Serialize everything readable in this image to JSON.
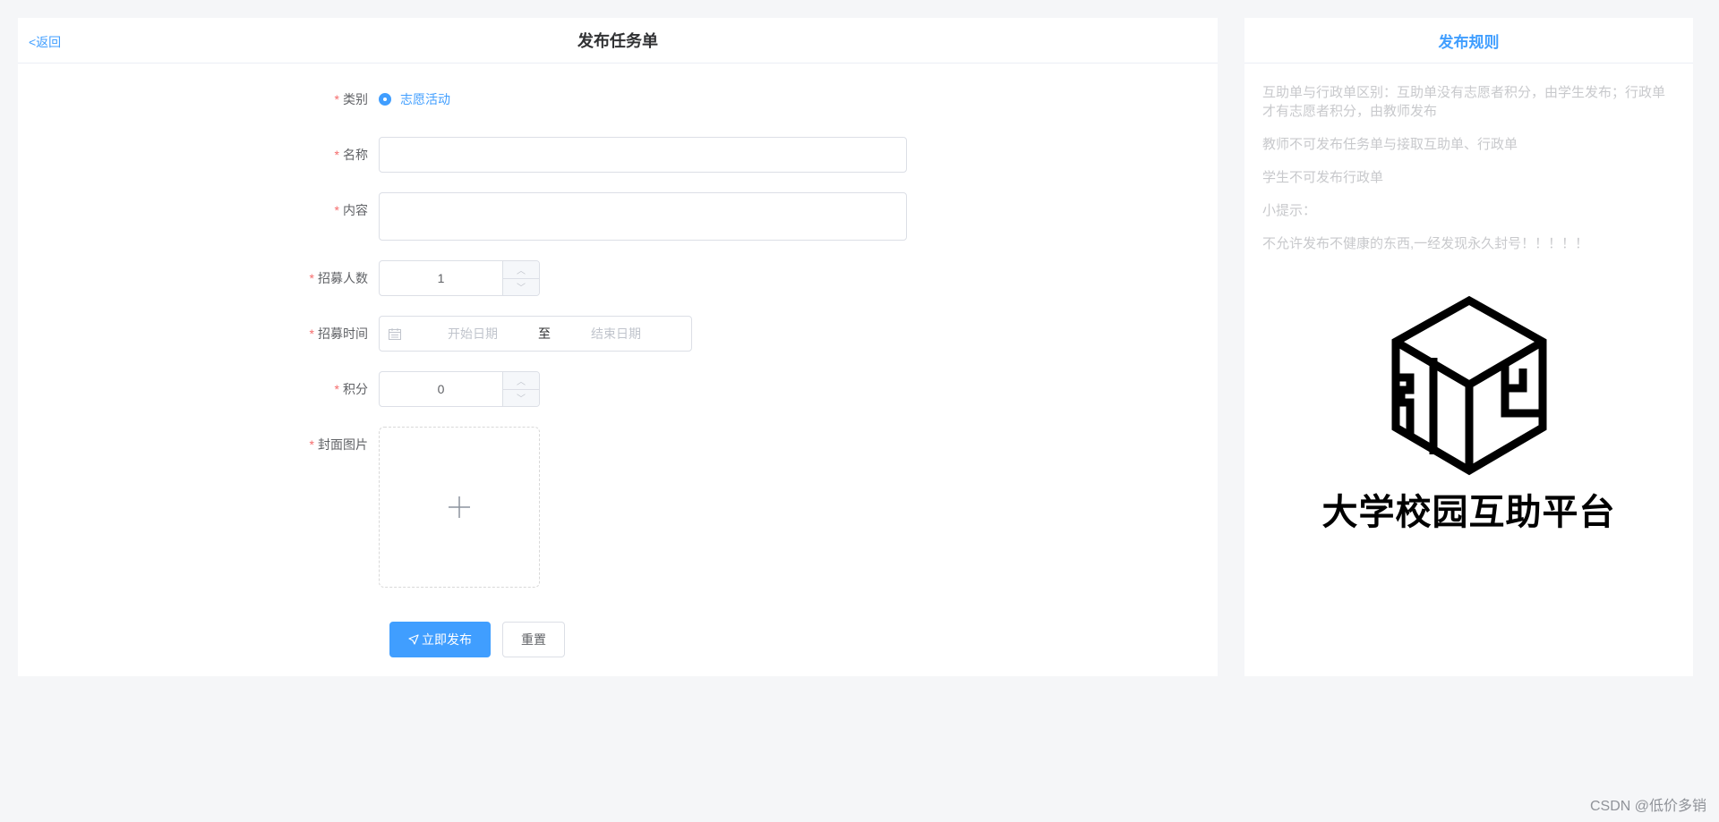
{
  "header": {
    "back_label": "<返回",
    "title": "发布任务单"
  },
  "form": {
    "category": {
      "label": "类别",
      "selected": "志愿活动"
    },
    "name": {
      "label": "名称",
      "value": ""
    },
    "content": {
      "label": "内容",
      "value": ""
    },
    "recruit_count": {
      "label": "招募人数",
      "value": "1"
    },
    "recruit_time": {
      "label": "招募时间",
      "start_placeholder": "开始日期",
      "separator": "至",
      "end_placeholder": "结束日期"
    },
    "points": {
      "label": "积分",
      "value": "0"
    },
    "cover_image": {
      "label": "封面图片"
    },
    "submit_label": "立即发布",
    "reset_label": "重置"
  },
  "rules": {
    "title": "发布规则",
    "lines": [
      "互助单与行政单区别：互助单没有志愿者积分，由学生发布；行政单才有志愿者积分，由教师发布",
      "教师不可发布任务单与接取互助单、行政单",
      "学生不可发布行政单",
      "小提示：",
      "不允许发布不健康的东西,一经发现永久封号！！！！！"
    ],
    "logo_caption": "大学校园互助平台"
  },
  "watermark": "CSDN @低价多销",
  "colors": {
    "primary": "#409eff",
    "required": "#f56c6c",
    "background": "#f5f6f8"
  },
  "icons": {
    "calendar": "calendar-icon",
    "plus": "plus-icon",
    "send": "send-icon",
    "logo": "cube-logo-icon"
  }
}
